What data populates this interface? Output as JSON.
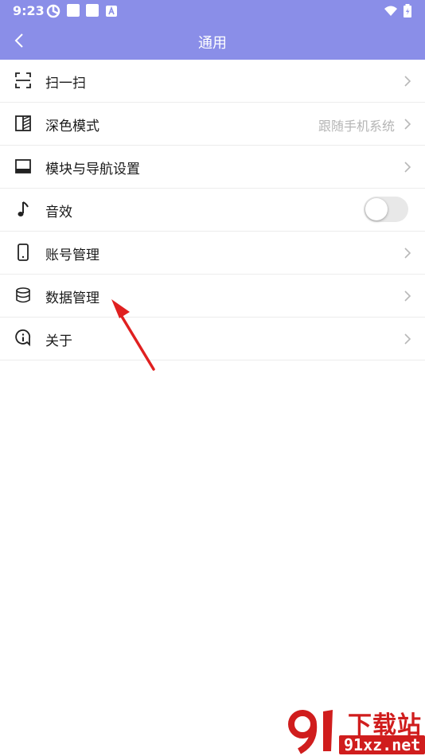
{
  "status_bar": {
    "time": "9:23"
  },
  "header": {
    "title": "通用"
  },
  "settings": {
    "items": [
      {
        "label": "扫一扫"
      },
      {
        "label": "深色模式",
        "value": "跟随手机系统"
      },
      {
        "label": "模块与导航设置"
      },
      {
        "label": "音效",
        "toggle_on": false
      },
      {
        "label": "账号管理"
      },
      {
        "label": "数据管理"
      },
      {
        "label": "关于"
      }
    ]
  },
  "watermark": {
    "title": "下载站",
    "url": "91xz.net"
  },
  "colors": {
    "header_bg": "#8a8ee8",
    "arrow": "#e02020",
    "watermark": "#d01d1d"
  }
}
